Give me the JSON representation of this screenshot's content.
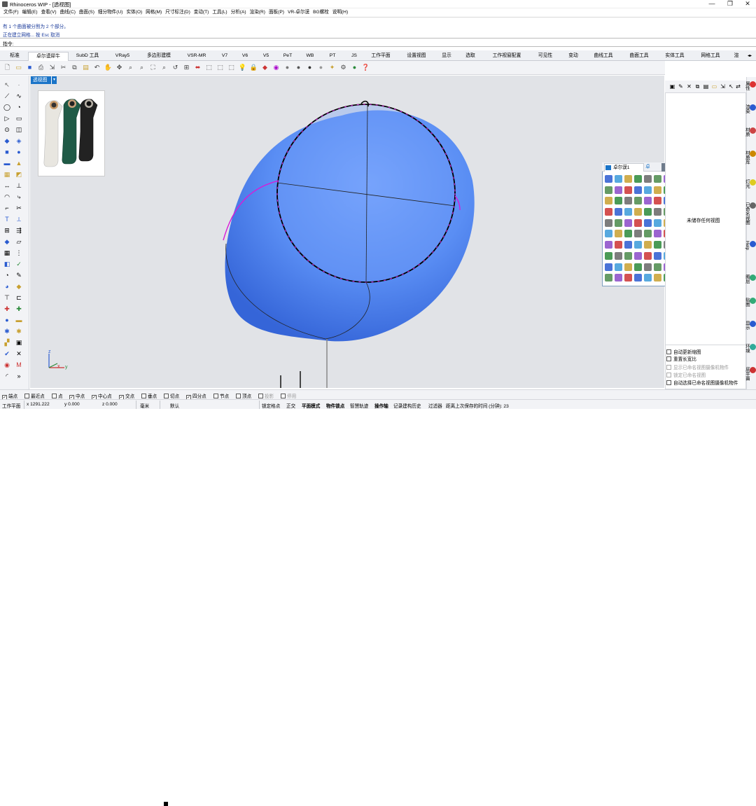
{
  "window": {
    "title": "Rhinoceros WIP - [透视图]",
    "controls": [
      "—",
      "❐",
      "✕"
    ]
  },
  "menu": [
    "文件(F)",
    "编辑(E)",
    "查看(V)",
    "曲线(C)",
    "曲面(S)",
    "细分物件(U)",
    "实体(O)",
    "网格(M)",
    "尺寸标注(D)",
    "变动(T)",
    "工具(L)",
    "分析(A)",
    "渲染(R)",
    "面板(P)",
    "VR-卓尔谟",
    "BG螺栓",
    "说明(H)"
  ],
  "command_history": [
    "有 1 个曲面被分割为 2 个部分。",
    "正在建立网格... 按 Esc 取消"
  ],
  "command_prompt": "指令:",
  "tabs": [
    "标准",
    "卓尔谟犀牛",
    "SubD 工具",
    "VRay5",
    "多边形建模",
    "VSR-MR",
    "V7",
    "V6",
    "V5",
    "PeT",
    "WB",
    "PT",
    "JS",
    "工作平面",
    "设置视图",
    "显示",
    "选取",
    "工作视窗配置",
    "可见性",
    "变动",
    "曲线工具",
    "曲面工具",
    "实体工具",
    "网格工具",
    "渲"
  ],
  "viewport": {
    "name": "透视图",
    "axis_labels": [
      "z",
      "x",
      "y"
    ]
  },
  "floating_toolbar": {
    "tab1": "卓尔谟1",
    "tab2": "卓"
  },
  "right_panel": {
    "empty_note": "未储存任何视图",
    "options": [
      {
        "label": "自动更新缩图",
        "enabled": true
      },
      {
        "label": "重置长宽比",
        "enabled": true
      },
      {
        "label": "显示已命名视图摄像机物件",
        "enabled": false
      },
      {
        "label": "锁定已命名视图",
        "enabled": false
      },
      {
        "label": "自动选择已命名视图摄像机物件",
        "enabled": true
      }
    ],
    "side_tabs": [
      {
        "label": "属性",
        "color": "#d33"
      },
      {
        "label": "渲染",
        "color": "#2a5bd0"
      },
      {
        "label": "材质",
        "color": "#c44"
      },
      {
        "label": "材质库",
        "color": "#c80"
      },
      {
        "label": "灯光",
        "color": "#dc2"
      },
      {
        "label": "已命名视图",
        "color": "#666"
      },
      {
        "label": "Help",
        "color": "#2a5bd0"
      },
      {
        "label": "图层",
        "color": "#3a7"
      },
      {
        "label": "贴图",
        "color": "#3a7"
      },
      {
        "label": "显示",
        "color": "#2a5bd0"
      },
      {
        "label": "环境",
        "color": "#3a9"
      },
      {
        "label": "底平面",
        "color": "#c33"
      }
    ]
  },
  "osnaps": [
    {
      "label": "端点",
      "checked": true
    },
    {
      "label": "最近点",
      "checked": false
    },
    {
      "label": "点",
      "checked": false
    },
    {
      "label": "中点",
      "checked": true
    },
    {
      "label": "中心点",
      "checked": true
    },
    {
      "label": "交点",
      "checked": true
    },
    {
      "label": "垂点",
      "checked": false
    },
    {
      "label": "切点",
      "checked": false
    },
    {
      "label": "四分点",
      "checked": true
    },
    {
      "label": "节点",
      "checked": false
    },
    {
      "label": "顶点",
      "checked": false
    },
    {
      "label": "投影",
      "checked": false,
      "dim": true
    },
    {
      "label": "停用",
      "checked": false,
      "dim": true
    }
  ],
  "status": {
    "cplane": "工作平面",
    "x": "x 1291.222",
    "y": "y 0.000",
    "z": "z 0.000",
    "units": "毫米",
    "layer": "默认",
    "toggles": [
      "锁定格点",
      "正交",
      "平面模式",
      "物件锁点",
      "智慧轨迹",
      "操作轴",
      "记录建构历史",
      "过滤器"
    ],
    "bold_toggles": [
      "平面模式",
      "物件锁点",
      "操作轴"
    ],
    "save_info": "距离上次保存的时间 (分钟): 23"
  },
  "colors": {
    "accent": "#1a74c8",
    "surface_blue": "#5b8ff5",
    "selection_magenta": "#d81bd8"
  }
}
